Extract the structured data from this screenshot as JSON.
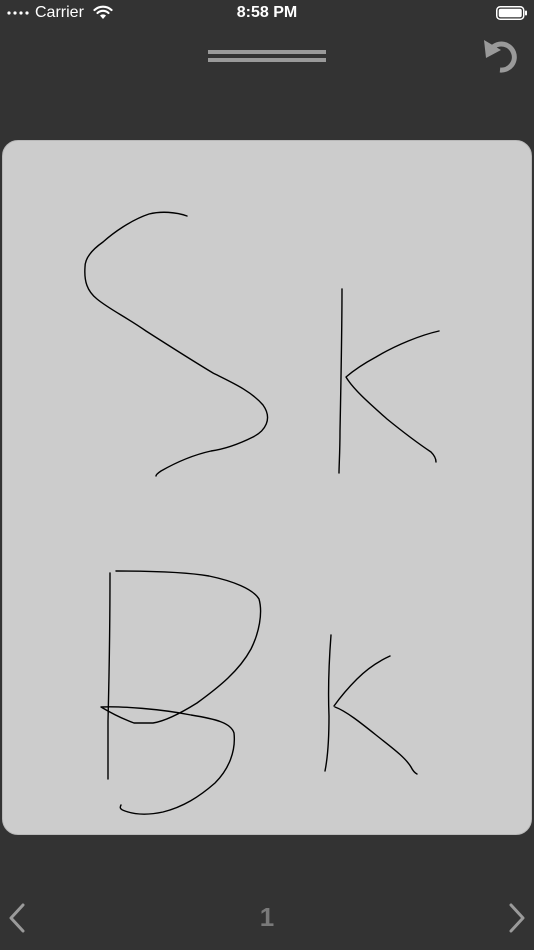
{
  "status_bar": {
    "carrier": "Carrier",
    "time": "8:58 PM",
    "signal_icon": "signal-dots-icon",
    "wifi_icon": "wifi-icon",
    "battery_icon": "battery-icon",
    "battery_level": 1.0
  },
  "toolbar": {
    "drag_handle_icon": "drag-handle-icon",
    "undo_icon": "undo-icon"
  },
  "pagination": {
    "page_number": "1",
    "prev_icon": "chevron-left-icon",
    "next_icon": "chevron-right-icon"
  },
  "colors": {
    "background": "#333333",
    "canvas": "#cccccc",
    "ink": "#000000",
    "control_gray": "#9a9a9a",
    "page_number": "#7a7a7a"
  }
}
